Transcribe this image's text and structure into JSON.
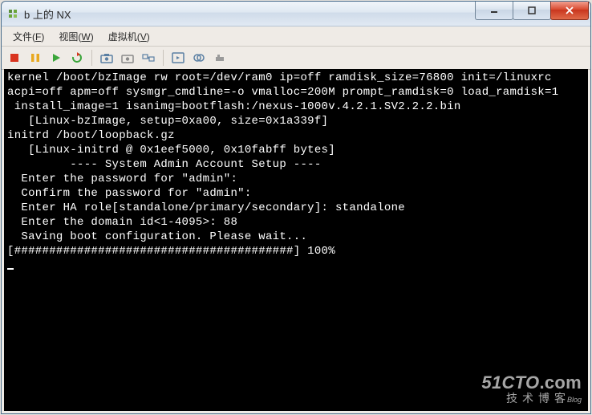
{
  "title": "b 上的 NX",
  "menus": {
    "file": "文件(F)",
    "view": "视图(W)",
    "vm": "虚拟机(V)",
    "file_u": "F",
    "view_u": "W",
    "vm_u": "V",
    "file_t": "文件",
    "view_t": "视图",
    "vm_t": "虚拟机"
  },
  "terminal": {
    "l1": "kernel /boot/bzImage rw root=/dev/ram0 ip=off ramdisk_size=76800 init=/linuxrc",
    "l2": "acpi=off apm=off sysmgr_cmdline=-o vmalloc=200M prompt_ramdisk=0 load_ramdisk=1",
    "l3": " install_image=1 isanimg=bootflash:/nexus-1000v.4.2.1.SV2.2.2.bin",
    "l4": "   [Linux-bzImage, setup=0xa00, size=0x1a339f]",
    "l5": "initrd /boot/loopback.gz",
    "l6": "   [Linux-initrd @ 0x1eef5000, 0x10fabff bytes]",
    "l7": "",
    "l8": "",
    "l9": "         ---- System Admin Account Setup ----",
    "l10": "",
    "l11": "",
    "l12": "  Enter the password for \"admin\":",
    "l13": "  Confirm the password for \"admin\":",
    "l14": "  Enter HA role[standalone/primary/secondary]: standalone",
    "l15": "",
    "l16": "  Enter the domain id<1-4095>: 88",
    "l17": "",
    "l18": "  Saving boot configuration. Please wait...",
    "l19": "",
    "l20": "[########################################] 100%"
  },
  "watermark": {
    "main": "51CTO",
    "suffix": ".com",
    "sub": "技术博客",
    "blog": "Blog"
  }
}
